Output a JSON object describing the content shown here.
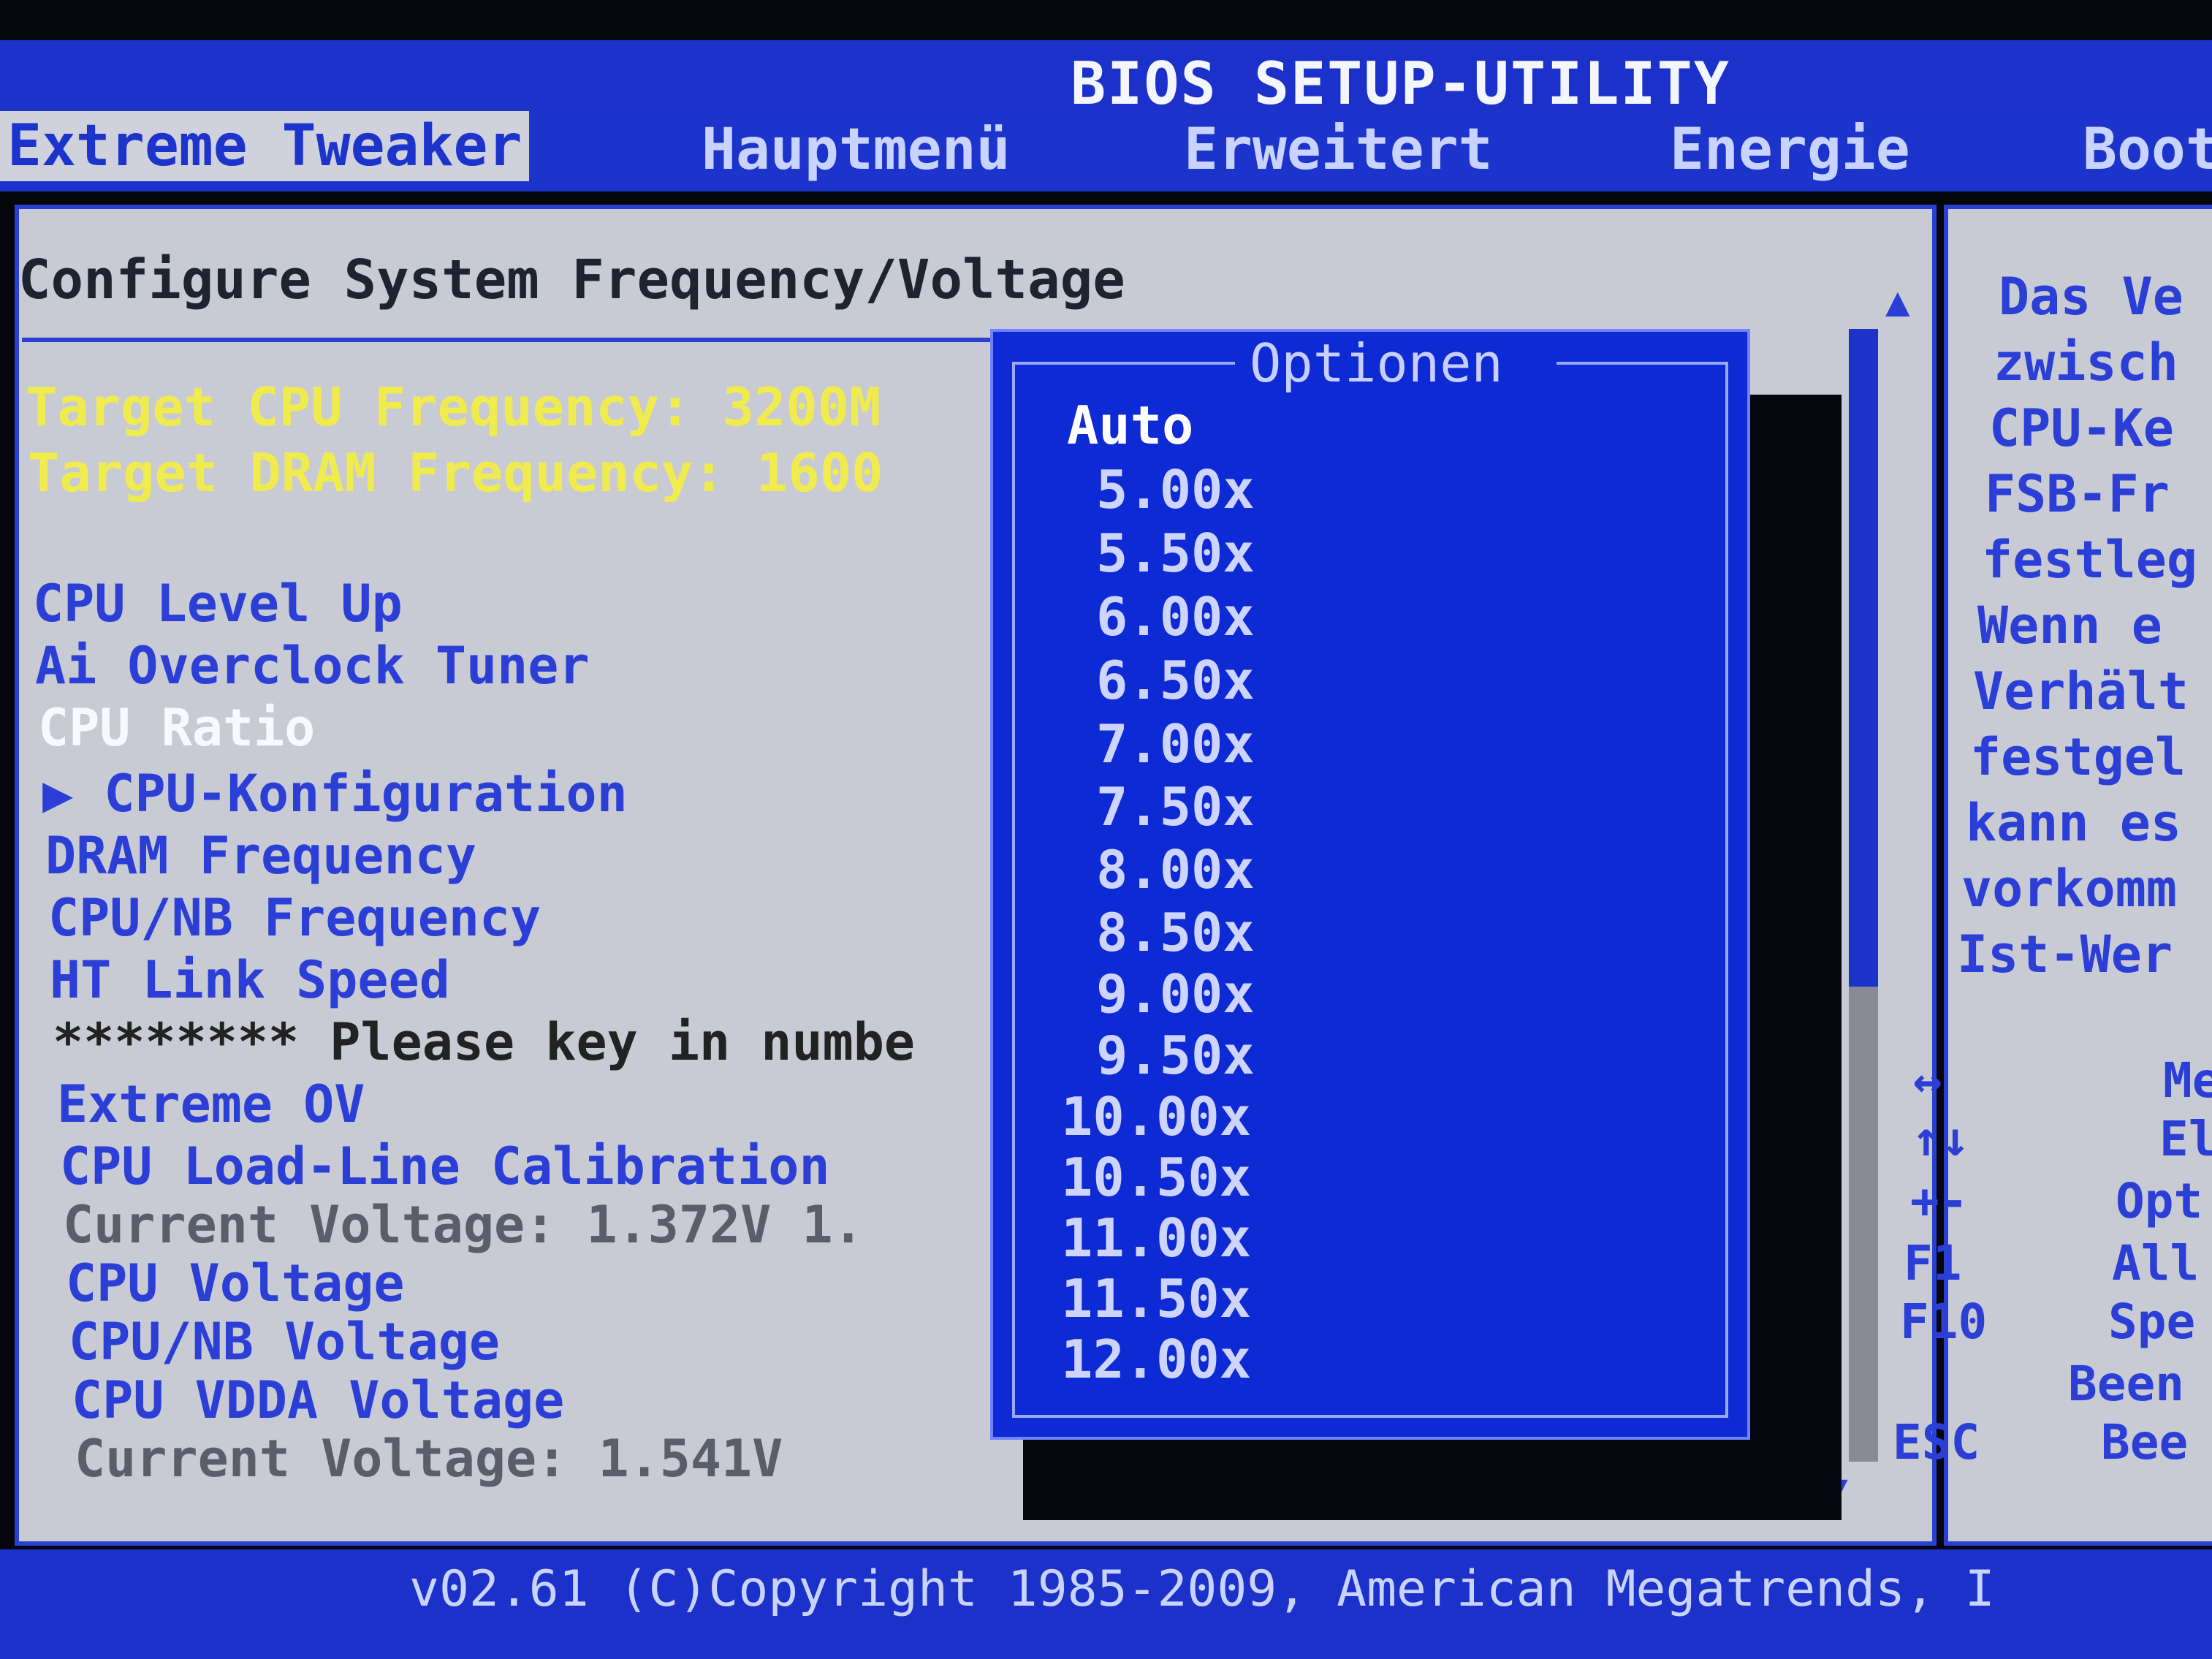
{
  "app": {
    "title": "BIOS SETUP-UTILITY"
  },
  "menu": {
    "tabs": [
      {
        "label": "Extreme Tweaker"
      },
      {
        "label": "Hauptmenü"
      },
      {
        "label": "Erweitert"
      },
      {
        "label": "Energie"
      },
      {
        "label": "Boot"
      }
    ]
  },
  "main": {
    "section_title": "Configure System Frequency/Voltage",
    "target_cpu": "Target CPU Frequency: 3200M",
    "target_dram": "Target DRAM Frequency: 1600",
    "items": [
      "CPU Level Up",
      "Ai Overclock Tuner",
      "CPU Ratio",
      "CPU-Konfiguration",
      "DRAM Frequency",
      "CPU/NB Frequency",
      "HT Link Speed",
      "******** Please key in numbe",
      "Extreme OV",
      "CPU Load-Line Calibration",
      "Current Voltage: 1.372V  1.",
      "CPU Voltage",
      "CPU/NB Voltage",
      "CPU VDDA Voltage",
      "Current Voltage: 1.541V"
    ],
    "submenu_arrow": "▶"
  },
  "popup": {
    "title": "Optionen",
    "options": [
      "Auto",
      "5.00x",
      "5.50x",
      "6.00x",
      "6.50x",
      "7.00x",
      "7.50x",
      "8.00x",
      "8.50x",
      "9.00x",
      "9.50x",
      "10.00x",
      "10.50x",
      "11.00x",
      "11.50x",
      "12.00x"
    ],
    "selected": "Auto"
  },
  "help": {
    "lines": [
      "Das Ve",
      "zwisch",
      "CPU-Ke",
      "FSB-Fr",
      "festleg",
      "Wenn e",
      "Verhält",
      "festgel",
      "kann es",
      "vorkomm",
      "Ist-Wer"
    ],
    "keys": [
      {
        "key": "↔",
        "desc": "Me"
      },
      {
        "key": "↑↓",
        "desc": "El"
      },
      {
        "key": "+-",
        "desc": "Opt"
      },
      {
        "key": "F1",
        "desc": "All"
      },
      {
        "key": "F10",
        "desc": "Spe"
      },
      {
        "key": "",
        "desc": "Been"
      },
      {
        "key": "ESC",
        "desc": "Bee"
      }
    ]
  },
  "footer": {
    "copyright": "v02.61 (C)Copyright 1985-2009, American Megatrends, I"
  },
  "colors": {
    "bios_blue": "#1c34cc",
    "panel_grey": "#c9cbd4",
    "highlight_yellow": "#f1ec4e",
    "popup_blue": "#0e2ad4"
  }
}
